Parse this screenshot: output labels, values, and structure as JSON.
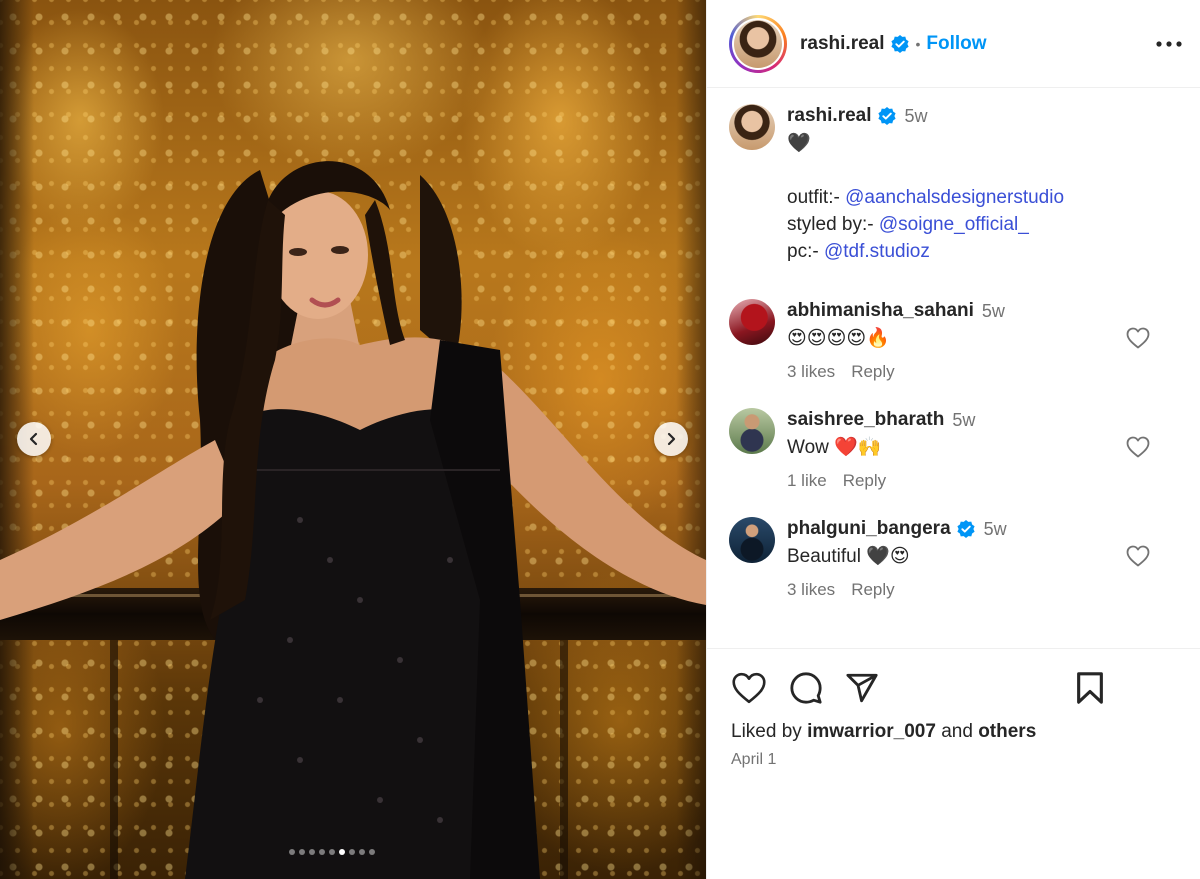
{
  "post": {
    "author": "rashi.real",
    "follow_label": "Follow",
    "separator": "•",
    "caption": {
      "time": "5w",
      "line1": "🖤",
      "outfit_label": "outfit:-",
      "outfit_mention": "@aanchalsdesignerstudio",
      "styled_label": "styled by:-",
      "styled_mention": "@soigne_official_",
      "pc_label": "pc:-",
      "pc_mention": "@tdf.studioz"
    },
    "carousel": {
      "total_slides": 9,
      "active_index": 5
    },
    "comments": [
      {
        "user": "abhimanisha_sahani",
        "time": "5w",
        "text": "😍😍😍😍🔥",
        "likes": "3 likes",
        "reply": "Reply",
        "verified": false
      },
      {
        "user": "saishree_bharath",
        "time": "5w",
        "text": "Wow ❤️🙌",
        "likes": "1 like",
        "reply": "Reply",
        "verified": false
      },
      {
        "user": "phalguni_bangera",
        "time": "5w",
        "text": "Beautiful 🖤😍",
        "likes": "3 likes",
        "reply": "Reply",
        "verified": true
      }
    ],
    "liked_by_prefix": "Liked by",
    "liked_by_user": "imwarrior_007",
    "liked_by_and": "and",
    "liked_by_others": "others",
    "date": "April 1",
    "colors": {
      "accent": "#0095f6",
      "mention": "#3a4fd6",
      "verified": "#0095f6",
      "muted": "#737373"
    },
    "icons": [
      "chevron-left-icon",
      "chevron-right-icon",
      "verified-badge-icon",
      "more-icon",
      "heart-icon",
      "comment-icon",
      "share-icon",
      "bookmark-icon"
    ]
  }
}
